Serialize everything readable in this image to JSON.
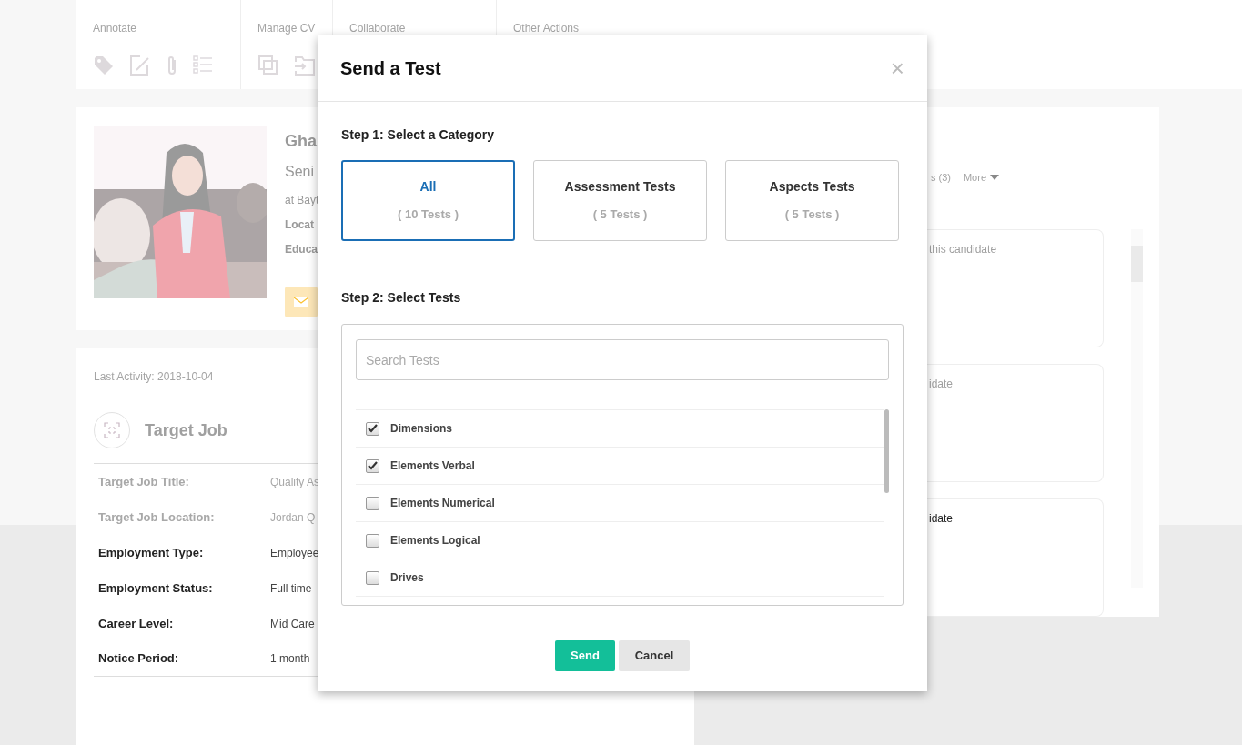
{
  "toolbar": {
    "groups": [
      {
        "label": "Annotate"
      },
      {
        "label": "Manage CV"
      },
      {
        "label": "Collaborate"
      },
      {
        "label": "Other Actions"
      }
    ]
  },
  "profile": {
    "name": "Gha",
    "title": "Seni",
    "company": "at Bayt",
    "fields": [
      "Locat",
      "Educa"
    ]
  },
  "activity": {
    "last_activity": "Last Activity: 2018-10-04"
  },
  "target_job": {
    "title": "Target Job",
    "rows": [
      {
        "label": "Target Job Title:",
        "value": "Quality As"
      },
      {
        "label": "Target Job Location:",
        "value": "Jordan Q"
      },
      {
        "label": "Employment Type:",
        "value": "Employee"
      },
      {
        "label": "Employment Status:",
        "value": "Full time"
      },
      {
        "label": "Career Level:",
        "value": "Mid Care"
      },
      {
        "label": "Notice Period:",
        "value": "1 month"
      }
    ]
  },
  "right_panel": {
    "tabs": [
      {
        "label": "s (3)"
      },
      {
        "label": "More"
      }
    ],
    "notes": [
      "this candidate",
      "idate",
      "idate"
    ]
  },
  "modal": {
    "title": "Send a Test",
    "close": "×",
    "step1": "Step 1: Select a Category",
    "categories": [
      {
        "name": "All",
        "count": "( 10 Tests )",
        "selected": true
      },
      {
        "name": "Assessment Tests",
        "count": "( 5 Tests )",
        "selected": false
      },
      {
        "name": "Aspects Tests",
        "count": "( 5 Tests )",
        "selected": false
      }
    ],
    "step2": "Step 2: Select Tests",
    "search": {
      "placeholder": "Search Tests"
    },
    "tests": [
      {
        "name": "Dimensions",
        "checked": true
      },
      {
        "name": "Elements Verbal",
        "checked": true
      },
      {
        "name": "Elements Numerical",
        "checked": false
      },
      {
        "name": "Elements Logical",
        "checked": false
      },
      {
        "name": "Drives",
        "checked": false
      }
    ],
    "buttons": [
      {
        "label": "Send",
        "kind": "primary"
      },
      {
        "label": "Cancel",
        "kind": "secondary"
      }
    ]
  }
}
